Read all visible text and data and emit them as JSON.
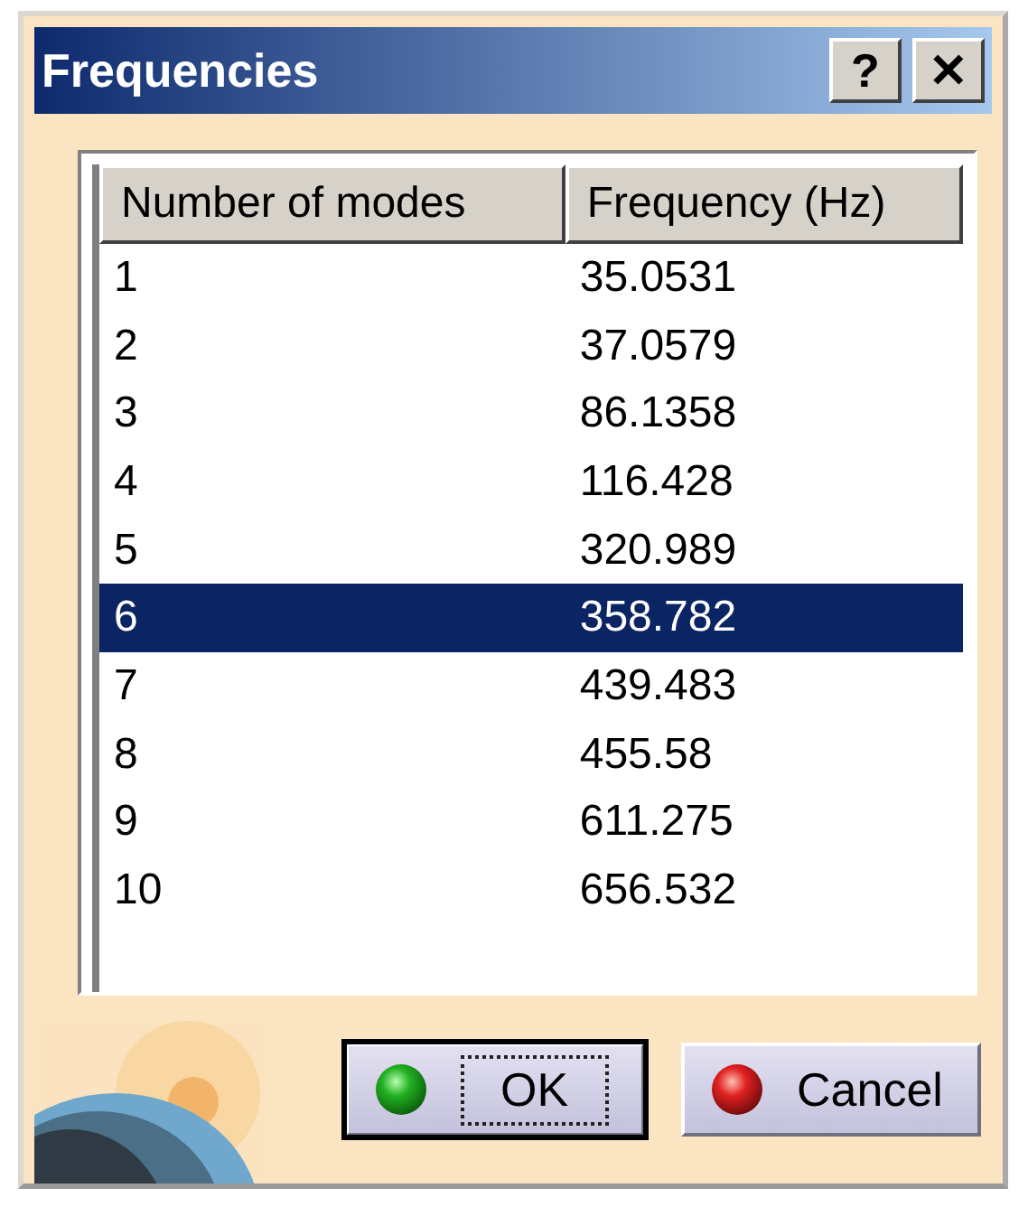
{
  "window": {
    "title": "Frequencies",
    "help_button": "?",
    "close_button": "✕"
  },
  "table": {
    "columns": [
      "Number of modes",
      "Frequency (Hz)"
    ],
    "rows": [
      {
        "cells": [
          "1",
          "35.0531"
        ],
        "selected": false
      },
      {
        "cells": [
          "2",
          "37.0579"
        ],
        "selected": false
      },
      {
        "cells": [
          "3",
          "86.1358"
        ],
        "selected": false
      },
      {
        "cells": [
          "4",
          "116.428"
        ],
        "selected": false
      },
      {
        "cells": [
          "5",
          "320.989"
        ],
        "selected": false
      },
      {
        "cells": [
          "6",
          "358.782"
        ],
        "selected": true
      },
      {
        "cells": [
          "7",
          "439.483"
        ],
        "selected": false
      },
      {
        "cells": [
          "8",
          "455.58"
        ],
        "selected": false
      },
      {
        "cells": [
          "9",
          "611.275"
        ],
        "selected": false
      },
      {
        "cells": [
          "10",
          "656.532"
        ],
        "selected": false
      }
    ]
  },
  "buttons": [
    {
      "label": "OK",
      "kind": "ok",
      "focused": true
    },
    {
      "label": "Cancel",
      "kind": "cancel",
      "focused": false
    }
  ]
}
